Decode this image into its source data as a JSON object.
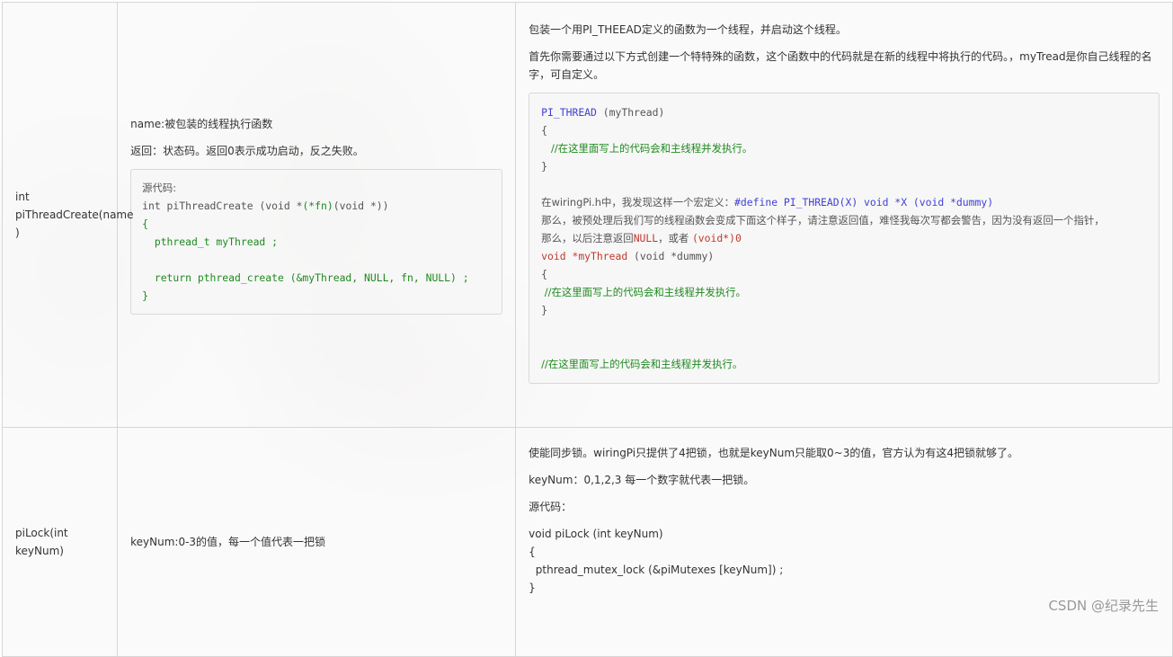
{
  "rows": [
    {
      "func": [
        "int",
        "piThreadCreate(name",
        ")"
      ],
      "params": {
        "p1": "name:被包装的线程执行函数",
        "p2": "返回：状态码。返回0表示成功启动，反之失败。",
        "code": {
          "l1": "源代码:",
          "l2_a": "int piThreadCreate ",
          "l2_b": "(void *",
          "l2_c": "(*fn)",
          "l2_d": "(void *)",
          "l2_e": ")",
          "l3": "{",
          "l4": "  pthread_t myThread ;",
          "l5": "",
          "l6": "  return pthread_create (&myThread, NULL, fn, NULL) ;",
          "l7": "}"
        }
      },
      "desc": {
        "p1": "包装一个用PI_THEEAD定义的函数为一个线程，并启动这个线程。",
        "p2": "首先你需要通过以下方式创建一个特特殊的函数，这个函数中的代码就是在新的线程中将执行的代码。，myTread是你自己线程的名字，可自定义。",
        "code": {
          "l1_a": "PI_THREAD",
          "l1_b": " (myThread)",
          "l2": "{",
          "l3": "   //在这里面写上的代码会和主线程并发执行。",
          "l4": "}",
          "l5_a": "在wiringPi.h中，我发现这样一个宏定义：",
          "l5_b": "#define PI_THREAD(X) void *X (void *dummy)",
          "l6": "那么，被预处理后我们写的线程函数会变成下面这个样子，请注意返回值，难怪我每次写都会警告，因为没有返回一个指针，",
          "l7_a": "那么，以后注意返回",
          "l7_b": "NULL",
          "l7_c": "，或者 ",
          "l7_d": "(void*)0",
          "l8_a": "void *myThread",
          "l8_b": " (void *dummy)",
          "l9": "{",
          "l10": " //在这里面写上的代码会和主线程并发执行。",
          "l11": "}",
          "l12": "//在这里面写上的代码会和主线程并发执行。"
        }
      }
    },
    {
      "func": [
        "piLock(int keyNum)"
      ],
      "params": {
        "p1": "keyNum:0-3的值，每一个值代表一把锁"
      },
      "desc": {
        "p1": "使能同步锁。wiringPi只提供了4把锁，也就是keyNum只能取0~3的值，官方认为有这4把锁就够了。",
        "p2": "keyNum：0,1,2,3 每一个数字就代表一把锁。",
        "p3": "源代码：",
        "c1": "void piLock (int keyNum)",
        "c2": "{",
        "c3": "  pthread_mutex_lock (&piMutexes [keyNum]) ;",
        "c4": "}"
      }
    }
  ],
  "watermark": "CSDN @纪录先生"
}
